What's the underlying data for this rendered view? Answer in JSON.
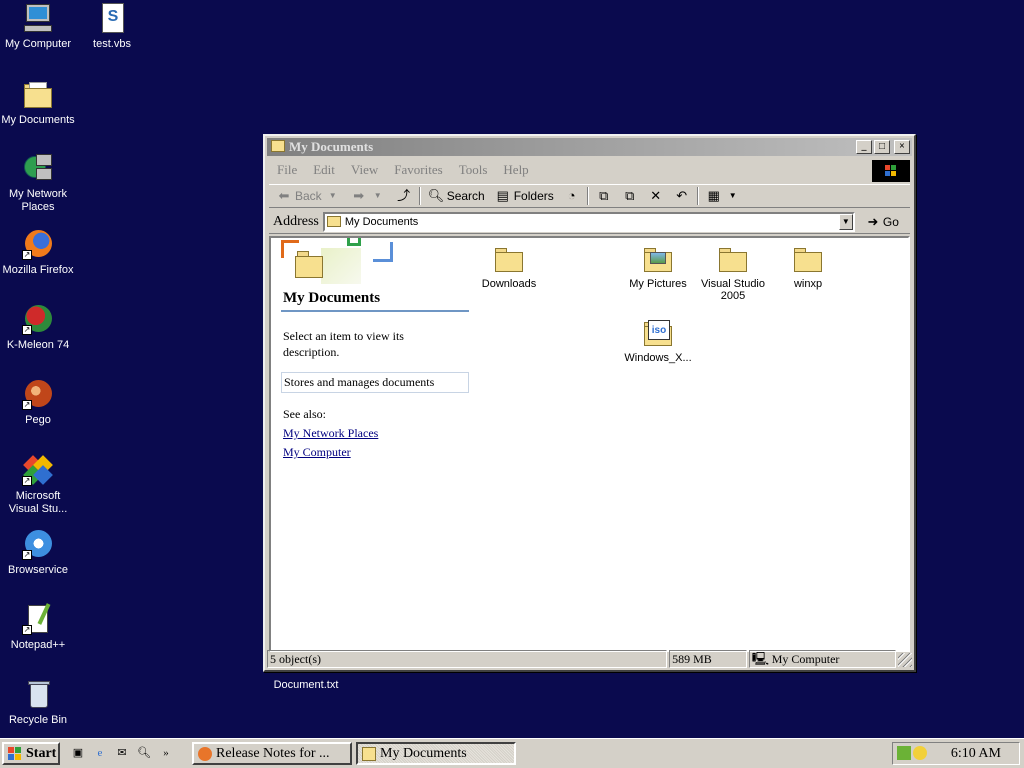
{
  "desktop": {
    "icons": [
      {
        "label": "My Computer"
      },
      {
        "label": "test.vbs"
      },
      {
        "label": "My Documents"
      },
      {
        "label": "My Network Places"
      },
      {
        "label": "Mozilla Firefox"
      },
      {
        "label": "K-Meleon 74"
      },
      {
        "label": "Pego"
      },
      {
        "label": "Microsoft Visual Stu..."
      },
      {
        "label": "Browservice"
      },
      {
        "label": "Notepad++"
      },
      {
        "label": "Recycle Bin"
      }
    ],
    "hidden_file_label": "New Text Document.txt"
  },
  "window": {
    "title": "My Documents",
    "buttons": {
      "minimize": "_",
      "maximize": "□",
      "close": "×"
    },
    "menu": [
      "File",
      "Edit",
      "View",
      "Favorites",
      "Tools",
      "Help"
    ],
    "toolbar": {
      "back": "Back",
      "search": "Search",
      "folders": "Folders"
    },
    "address": {
      "label": "Address",
      "value": "My Documents",
      "go": "Go"
    },
    "left_pane": {
      "title": "My Documents",
      "prompt": "Select an item to view its description.",
      "description": "Stores and manages documents",
      "see_also": "See also:",
      "links": [
        "My Network Places",
        "My Computer"
      ]
    },
    "files": [
      {
        "name": "Downloads",
        "type": "folder"
      },
      {
        "name": "My Pictures",
        "type": "pictures-folder"
      },
      {
        "name": "Visual Studio 2005",
        "type": "folder"
      },
      {
        "name": "winxp",
        "type": "folder"
      },
      {
        "name": "Windows_X...",
        "type": "iso-file"
      }
    ],
    "status": {
      "objects": "5 object(s)",
      "size": "589 MB",
      "zone": "My Computer"
    }
  },
  "taskbar": {
    "start": "Start",
    "chevron": "»",
    "tasks": [
      {
        "label": "Release Notes for ..."
      },
      {
        "label": "My Documents"
      }
    ],
    "clock": "6:10 AM"
  }
}
